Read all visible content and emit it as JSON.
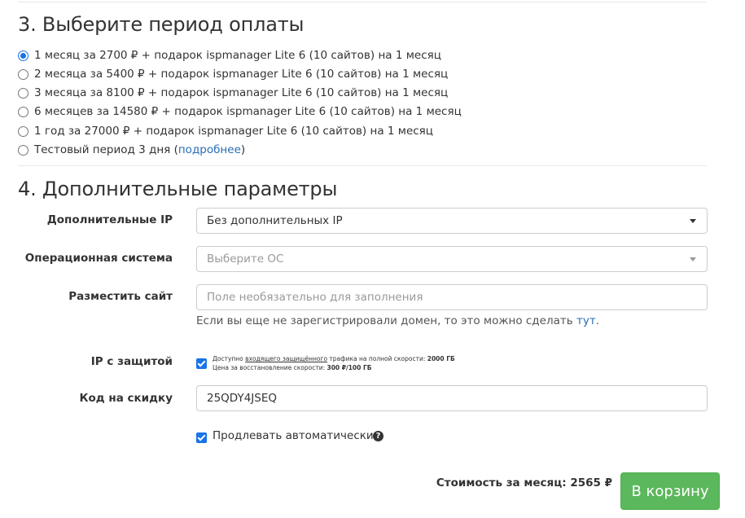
{
  "section3": {
    "title": "3. Выберите период оплаты",
    "options": [
      {
        "label": "1 месяц за 2700 ₽ + подарок ispmanager Lite 6 (10 сайтов) на 1 месяц",
        "checked": true
      },
      {
        "label": "2 месяца за 5400 ₽ + подарок ispmanager Lite 6 (10 сайтов) на 1 месяц",
        "checked": false
      },
      {
        "label": "3 месяца за 8100 ₽ + подарок ispmanager Lite 6 (10 сайтов) на 1 месяц",
        "checked": false
      },
      {
        "label": "6 месяцев за 14580 ₽ + подарок ispmanager Lite 6 (10 сайтов) на 1 месяц",
        "checked": false
      },
      {
        "label": "1 год за 27000 ₽ + подарок ispmanager Lite 6 (10 сайтов) на 1 месяц",
        "checked": false
      }
    ],
    "trial": {
      "prefix": "Тестовый период 3 дня (",
      "link": "подробнее",
      "suffix": ")",
      "checked": false
    }
  },
  "section4": {
    "title": "4. Дополнительные параметры",
    "extra_ip": {
      "label": "Дополнительные IP",
      "value": "Без дополнительных IP"
    },
    "os": {
      "label": "Операционная система",
      "placeholder": "Выберите ОС"
    },
    "site": {
      "label": "Разместить сайт",
      "placeholder": "Поле необязательно для заполнения",
      "help_prefix": "Если вы еще не зарегистрировали домен, то это можно сделать ",
      "help_link": "тут",
      "help_suffix": "."
    },
    "protected_ip": {
      "label": "IP с защитой",
      "checked": true,
      "line1_prefix": "Доступно ",
      "line1_link": "входящего защищённого",
      "line1_mid": " трафика на полной скорости: ",
      "line1_value": "2000 ГБ",
      "line2_prefix": "Цена за восстановление скорости: ",
      "line2_value": "300 ₽/100 ГБ"
    },
    "discount": {
      "label": "Код на скидку",
      "value": "25QDY4JSEQ"
    },
    "auto_renew": {
      "label": "Продлевать автоматически",
      "checked": true,
      "help_icon": "question-circle-icon"
    }
  },
  "footer": {
    "cost_label": "Стоимость за месяц: 2565 ₽",
    "cart_button": "В корзину"
  },
  "colors": {
    "accent": "#1a73e8",
    "link": "#2a6db5",
    "button": "#5cb85c"
  }
}
